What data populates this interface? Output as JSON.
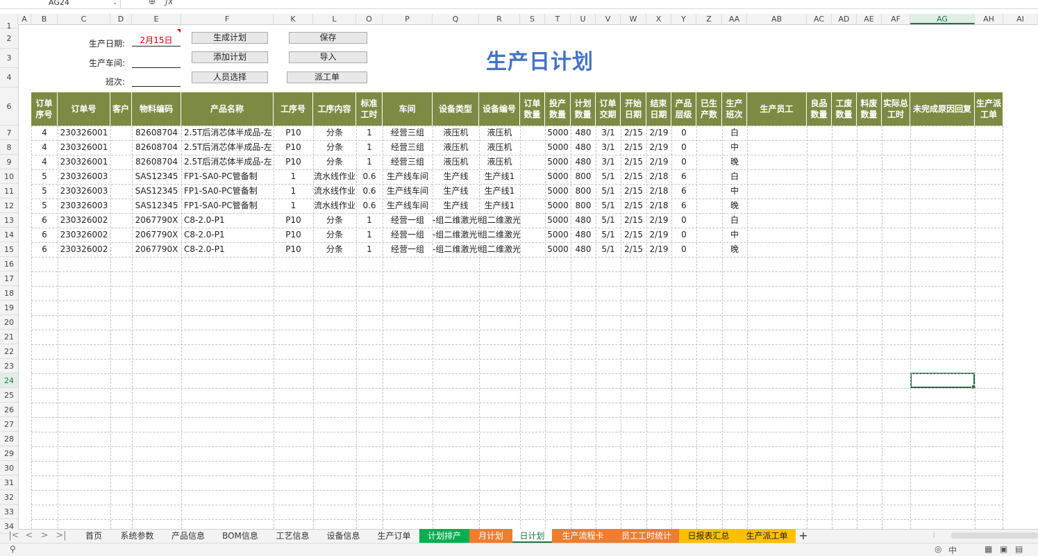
{
  "formula_bar": {
    "name_box": "AG24",
    "zoom_icon": "magnifier-icon",
    "fx_label": "ƒx"
  },
  "column_headers": [
    "A",
    "B",
    "C",
    "D",
    "E",
    "F",
    "K",
    "L",
    "O",
    "P",
    "Q",
    "R",
    "S",
    "T",
    "U",
    "V",
    "W",
    "X",
    "Y",
    "Z",
    "AA",
    "AB",
    "AC",
    "AD",
    "AE",
    "AF",
    "AG",
    "AH",
    "AI"
  ],
  "row_headers": [
    "1",
    "2",
    "3",
    "4",
    "6",
    "7",
    "8",
    "9",
    "10",
    "11",
    "12",
    "13",
    "14",
    "15",
    "16",
    "17",
    "18",
    "19",
    "20",
    "21",
    "22",
    "23",
    "24",
    "25",
    "26",
    "27",
    "28",
    "29",
    "30",
    "31",
    "32",
    "33",
    "34"
  ],
  "selected_row": "24",
  "selected_col": "AG",
  "form": {
    "date_label": "生产日期:",
    "date_value": "2月15日",
    "workshop_label": "生产车间:",
    "workshop_value": "",
    "shift_label": "班次:",
    "shift_value": ""
  },
  "buttons": {
    "generate": "生成计划",
    "add": "添加计划",
    "staff": "人员选择",
    "save": "保存",
    "import": "导入",
    "dispatch": "派工单"
  },
  "title": "生产日计划",
  "table": {
    "headers": [
      "订单\n序号",
      "订单号",
      "客户",
      "物料编码",
      "产品名称",
      "工序号",
      "工序内容",
      "标准\n工时",
      "车间",
      "设备类型",
      "设备编号",
      "订单\n数量",
      "投产\n数量",
      "计划\n数量",
      "订单\n交期",
      "开始\n日期",
      "结束\n日期",
      "产品\n层级",
      "已生\n产数",
      "生产\n班次",
      "生产员工",
      "良品\n数量",
      "工废\n数量",
      "料废\n数量",
      "实际总\n工时",
      "未完成原因回复",
      "生产派\n工单"
    ],
    "rows": [
      [
        "4",
        "230326001",
        "",
        "82608704",
        "2.5T后消芯体半成品-左",
        "P10",
        "分条",
        "1",
        "经营三组",
        "液压机",
        "液压机",
        "",
        "5000",
        "480",
        "3/1",
        "2/15",
        "2/19",
        "0",
        "",
        "白",
        "",
        "",
        "",
        "",
        "",
        "",
        ""
      ],
      [
        "4",
        "230326001",
        "",
        "82608704",
        "2.5T后消芯体半成品-左",
        "P10",
        "分条",
        "1",
        "经营三组",
        "液压机",
        "液压机",
        "",
        "5000",
        "480",
        "3/1",
        "2/15",
        "2/19",
        "0",
        "",
        "中",
        "",
        "",
        "",
        "",
        "",
        "",
        ""
      ],
      [
        "4",
        "230326001",
        "",
        "82608704",
        "2.5T后消芯体半成品-左",
        "P10",
        "分条",
        "1",
        "经营三组",
        "液压机",
        "液压机",
        "",
        "5000",
        "480",
        "3/1",
        "2/15",
        "2/19",
        "0",
        "",
        "晚",
        "",
        "",
        "",
        "",
        "",
        "",
        ""
      ],
      [
        "5",
        "230326003",
        "",
        "SAS12345",
        "FP1-SA0-PC管备制",
        "1",
        "流水线作业",
        "0.6",
        "生产线车间",
        "生产线",
        "生产线1",
        "",
        "5000",
        "800",
        "5/1",
        "2/15",
        "2/18",
        "6",
        "",
        "白",
        "",
        "",
        "",
        "",
        "",
        "",
        ""
      ],
      [
        "5",
        "230326003",
        "",
        "SAS12345",
        "FP1-SA0-PC管备制",
        "1",
        "流水线作业",
        "0.6",
        "生产线车间",
        "生产线",
        "生产线1",
        "",
        "5000",
        "800",
        "5/1",
        "2/15",
        "2/18",
        "6",
        "",
        "中",
        "",
        "",
        "",
        "",
        "",
        "",
        ""
      ],
      [
        "5",
        "230326003",
        "",
        "SAS12345",
        "FP1-SA0-PC管备制",
        "1",
        "流水线作业",
        "0.6",
        "生产线车间",
        "生产线",
        "生产线1",
        "",
        "5000",
        "800",
        "5/1",
        "2/15",
        "2/18",
        "6",
        "",
        "晚",
        "",
        "",
        "",
        "",
        "",
        "",
        ""
      ],
      [
        "6",
        "230326002",
        "",
        "2067790X",
        "C8-2.0-P1",
        "P10",
        "分条",
        "1",
        "经营一组",
        "-组二维激光切",
        "组二维激光切",
        "",
        "5000",
        "480",
        "5/1",
        "2/15",
        "2/19",
        "0",
        "",
        "白",
        "",
        "",
        "",
        "",
        "",
        "",
        ""
      ],
      [
        "6",
        "230326002",
        "",
        "2067790X",
        "C8-2.0-P1",
        "P10",
        "分条",
        "1",
        "经营一组",
        "-组二维激光切",
        "组二维激光切",
        "",
        "5000",
        "480",
        "5/1",
        "2/15",
        "2/19",
        "0",
        "",
        "中",
        "",
        "",
        "",
        "",
        "",
        "",
        ""
      ],
      [
        "6",
        "230326002",
        "",
        "2067790X",
        "C8-2.0-P1",
        "P10",
        "分条",
        "1",
        "经营一组",
        "-组二维激光切",
        "组二维激光切",
        "",
        "5000",
        "480",
        "5/1",
        "2/15",
        "2/19",
        "0",
        "",
        "晚",
        "",
        "",
        "",
        "",
        "",
        "",
        ""
      ]
    ]
  },
  "sheet_tabs": [
    {
      "label": "首页",
      "color": ""
    },
    {
      "label": "系统参数",
      "color": ""
    },
    {
      "label": "产品信息",
      "color": ""
    },
    {
      "label": "BOM信息",
      "color": ""
    },
    {
      "label": "工艺信息",
      "color": ""
    },
    {
      "label": "设备信息",
      "color": ""
    },
    {
      "label": "生产订单",
      "color": ""
    },
    {
      "label": "计划排产",
      "color": "#00b050"
    },
    {
      "label": "月计划",
      "color": "#ed7d31"
    },
    {
      "label": "日计划",
      "color": "",
      "active": true
    },
    {
      "label": "生产流程卡",
      "color": "#ed7d31"
    },
    {
      "label": "员工工时统计",
      "color": "#ed7d31"
    },
    {
      "label": "日报表汇总",
      "color": "#ffc000"
    },
    {
      "label": "生产派工单",
      "color": "#ffc000"
    }
  ],
  "tab_nav": [
    "|<",
    "<",
    ">",
    ">|"
  ],
  "add_tab": "+",
  "status": {
    "left_icon": "macro-record-icon",
    "ime": "中",
    "right_icons": [
      "eye-icon",
      "normal-view-icon",
      "page-layout-icon",
      "page-break-icon"
    ]
  },
  "colors": {
    "header_bg": "#7d8a43",
    "title": "#4472c4",
    "date_red": "#c00000",
    "accent": "#217346"
  }
}
